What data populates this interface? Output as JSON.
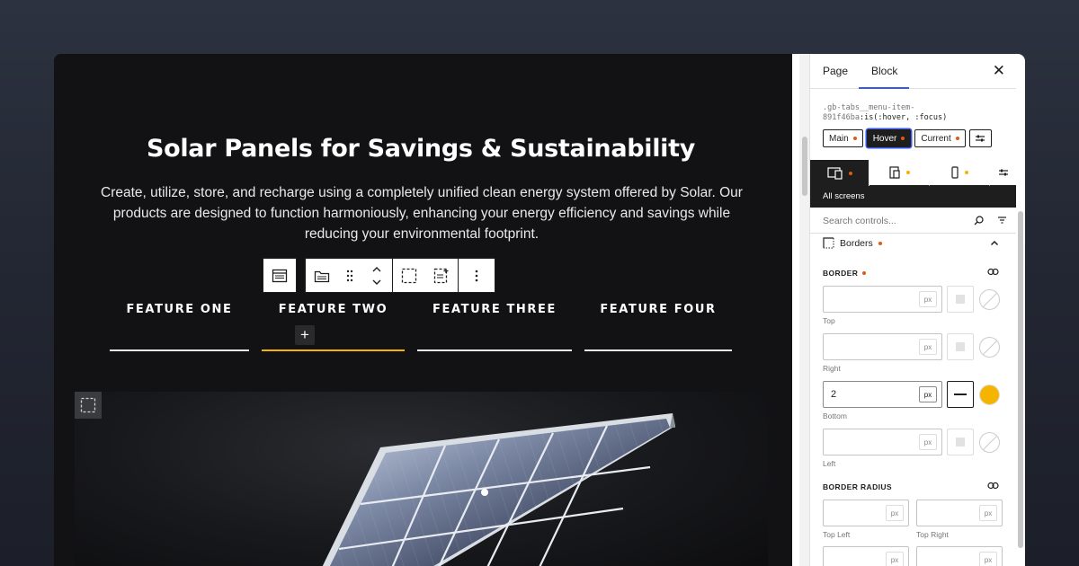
{
  "canvas": {
    "hero_title": "Solar Panels for Savings & Sustainability",
    "hero_text": "Create, utilize, store, and recharge using a completely unified clean energy system offered by Solar. Our products are designed to function harmoniously, enhancing your energy efficiency and savings while reducing your environmental footprint.",
    "tabs": [
      {
        "label": "FEATURE ONE",
        "active": false
      },
      {
        "label": "FEATURE TWO",
        "active": true
      },
      {
        "label": "FEATURE THREE",
        "active": false
      },
      {
        "label": "FEATURE FOUR",
        "active": false
      }
    ],
    "add_block_symbol": "+",
    "active_tab_color": "#f5b400"
  },
  "sidebar": {
    "tabs": {
      "page": "Page",
      "block": "Block"
    },
    "close_symbol": "✕",
    "selector_line1": ".gb-tabs__menu-item-",
    "selector_line2_prefix": "891f46ba",
    "selector_line2_suffix": ":is(:hover, :focus)",
    "states": [
      {
        "label": "Main",
        "active": false
      },
      {
        "label": "Hover",
        "active": true
      },
      {
        "label": "Current",
        "active": false
      }
    ],
    "device_label": "All screens",
    "search_placeholder": "Search controls...",
    "panel_title": "Borders",
    "border_label": "BORDER",
    "border_fields": [
      {
        "caption": "Top",
        "value": "",
        "unit": "px",
        "style_set": false,
        "color": ""
      },
      {
        "caption": "Right",
        "value": "",
        "unit": "px",
        "style_set": false,
        "color": ""
      },
      {
        "caption": "Bottom",
        "value": "2",
        "unit": "px",
        "style_set": true,
        "color": "#f5b400"
      },
      {
        "caption": "Left",
        "value": "",
        "unit": "px",
        "style_set": false,
        "color": ""
      }
    ],
    "radius_label": "BORDER RADIUS",
    "radius_fields": [
      {
        "caption": "Top Left",
        "unit": "px"
      },
      {
        "caption": "Top Right",
        "unit": "px"
      },
      {
        "caption": "",
        "unit": "px"
      },
      {
        "caption": "",
        "unit": "px"
      }
    ],
    "accent_color": "#3858e9",
    "indicator_color": "#e05a12"
  }
}
